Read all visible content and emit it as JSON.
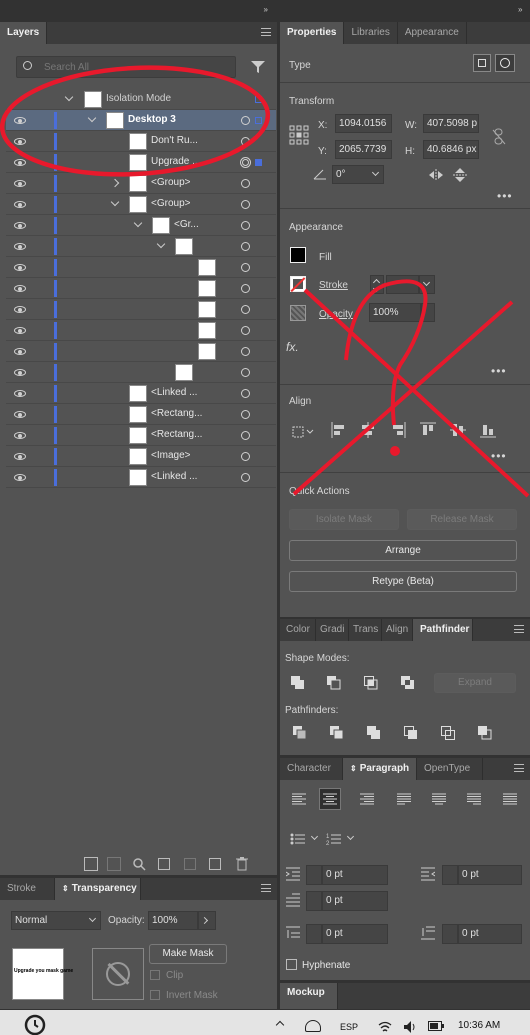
{
  "layers_panel": {
    "tab": "Layers",
    "search_placeholder": "Search All",
    "rows": [
      {
        "name": "Isolation Mode",
        "kind": "isolation"
      },
      {
        "name": "Desktop 3",
        "kind": "artboard"
      },
      {
        "name": "Don't Ru...",
        "kind": "item"
      },
      {
        "name": "Upgrade ...",
        "kind": "item"
      },
      {
        "name": "<Group>",
        "kind": "group"
      },
      {
        "name": "<Group>",
        "kind": "group"
      },
      {
        "name": "<Gr...",
        "kind": "group"
      },
      {
        "name": "",
        "kind": "item"
      },
      {
        "name": "",
        "kind": "item"
      },
      {
        "name": "",
        "kind": "item"
      },
      {
        "name": "",
        "kind": "item"
      },
      {
        "name": "",
        "kind": "item"
      },
      {
        "name": "",
        "kind": "item"
      },
      {
        "name": "",
        "kind": "item"
      },
      {
        "name": "<Linked ...",
        "kind": "item"
      },
      {
        "name": "<Rectang...",
        "kind": "item"
      },
      {
        "name": "<Rectang...",
        "kind": "item"
      },
      {
        "name": "<Image>",
        "kind": "item"
      },
      {
        "name": "<Linked ...",
        "kind": "item"
      }
    ]
  },
  "transparency_panel": {
    "tabs": [
      "Stroke",
      "Transparency"
    ],
    "blend_mode": "Normal",
    "opacity_label": "Opacity:",
    "opacity_value": "100%",
    "thumb_text": "Upgrade you mask game",
    "make_mask": "Make Mask",
    "clip": "Clip",
    "invert_mask": "Invert Mask"
  },
  "properties_panel": {
    "tabs": [
      "Properties",
      "Libraries",
      "Appearance"
    ],
    "type_label": "Type",
    "transform_label": "Transform",
    "x_label": "X:",
    "x_value": "1094.0156",
    "y_label": "Y:",
    "y_value": "2065.7739",
    "w_label": "W:",
    "w_value": "407.5098 p",
    "h_label": "H:",
    "h_value": "40.6846 px",
    "angle_value": "0°",
    "appearance_label": "Appearance",
    "fill_label": "Fill",
    "stroke_label": "Stroke",
    "opacity_label": "Opacity",
    "opacity_value": "100%",
    "fx_label": "fx.",
    "align_label": "Align",
    "quick_actions_label": "Quick Actions",
    "isolate_mask": "Isolate Mask",
    "release_mask": "Release Mask",
    "arrange": "Arrange",
    "retype": "Retype (Beta)"
  },
  "pathfinder_panel": {
    "tabs": [
      "Color",
      "Gradi",
      "Trans",
      "Align",
      "Pathfinder"
    ],
    "shape_modes_label": "Shape Modes:",
    "expand": "Expand",
    "pathfinders_label": "Pathfinders:"
  },
  "paragraph_panel": {
    "tabs": [
      "Character",
      "Paragraph",
      "OpenType"
    ],
    "left_indent": "0 pt",
    "right_indent": "0 pt",
    "first_line_indent": "0 pt",
    "space_before": "0 pt",
    "space_after": "0 pt",
    "hyphenate_label": "Hyphenate"
  },
  "mockup_tab": "Mockup",
  "taskbar": {
    "language": "ESP",
    "time": "10:36 AM"
  },
  "annotation_color": "#e8192c"
}
